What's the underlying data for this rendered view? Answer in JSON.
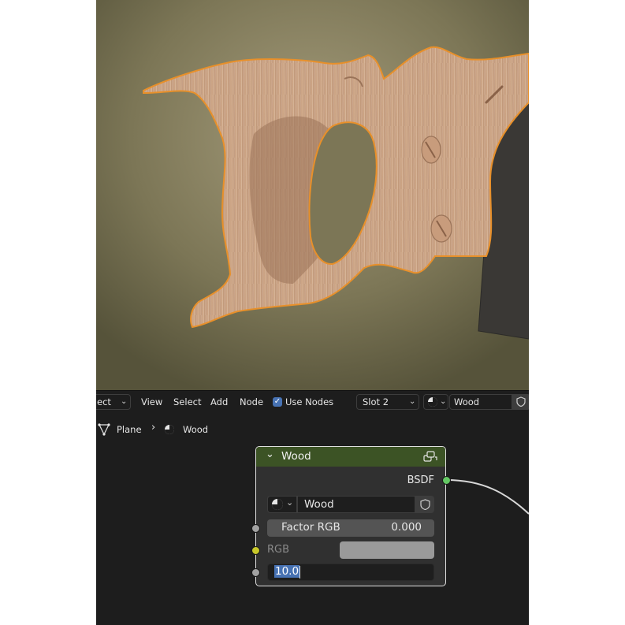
{
  "colors": {
    "selection_outline": "#e8902a",
    "node_header": "#3c5325",
    "shader_socket": "#63c763",
    "color_socket": "#c7c729",
    "value_socket": "#a1a1a1",
    "accent": "#4772b3"
  },
  "editor_header": {
    "mode_select": "ect",
    "menu": [
      "View",
      "Select",
      "Add",
      "Node"
    ],
    "use_nodes_label": "Use Nodes",
    "use_nodes_checked": true,
    "slot": "Slot 2",
    "material_name": "Wood"
  },
  "breadcrumb": {
    "object": "Plane",
    "material": "Wood"
  },
  "node": {
    "title": "Wood",
    "output_label": "BSDF",
    "material_name": "Wood",
    "factor_label": "Factor RGB",
    "factor_value": "0.000",
    "rgb_label": "RGB",
    "value_field": "10.0"
  }
}
